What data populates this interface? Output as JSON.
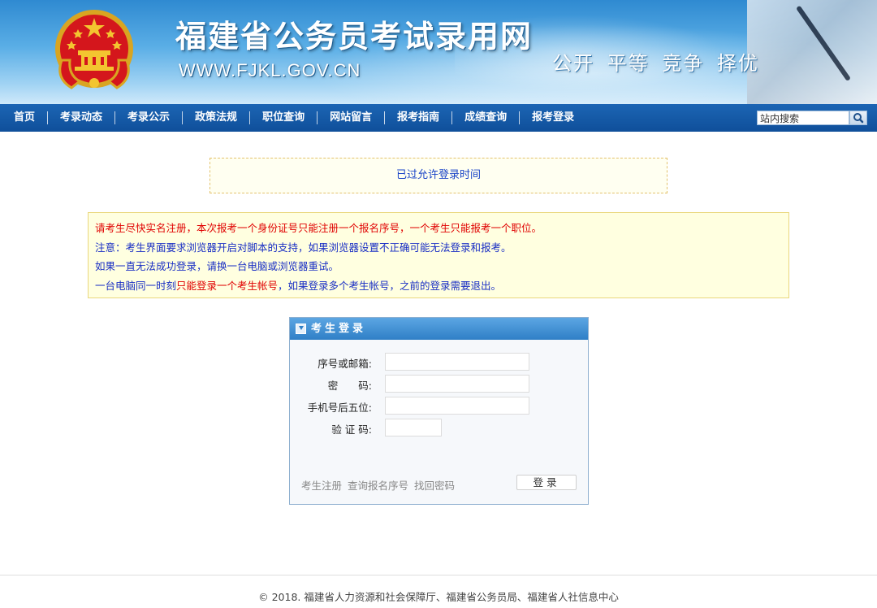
{
  "header": {
    "site_title": "福建省公务员考试录用网",
    "site_url": "WWW.FJKL.GOV.CN",
    "slogan": "公开 平等 竞争 择优"
  },
  "nav": {
    "items": [
      "首页",
      "考录动态",
      "考录公示",
      "政策法规",
      "职位查询",
      "网站留言",
      "报考指南",
      "成绩查询",
      "报考登录"
    ],
    "search_placeholder": "站内搜索"
  },
  "notice": {
    "login_time": "已过允许登录时间"
  },
  "warnings": {
    "line1": "请考生尽快实名注册，本次报考一个身份证号只能注册一个报名序号，一个考生只能报考一个职位。",
    "line2": "注意：考生界面要求浏览器开启对脚本的支持，如果浏览器设置不正确可能无法登录和报考。",
    "line3": "如果一直无法成功登录，请换一台电脑或浏览器重试。",
    "line4_a": "一台电脑同一时刻",
    "line4_b": "只能登录一个考生帐号",
    "line4_c": "，如果登录多个考生帐号，之前的登录需要退出。"
  },
  "login": {
    "title": "考生登录",
    "fields": {
      "id_label": "序号或邮箱:",
      "password_label": "密　　码:",
      "phone_label": "手机号后五位:",
      "captcha_label": "验 证 码:"
    },
    "links": [
      "考生注册",
      "查询报名序号",
      "找回密码"
    ],
    "submit": "登录"
  },
  "footer": {
    "copyright": "© 2018. 福建省人力资源和社会保障厅、福建省公务员局、福建省人社信息中心"
  },
  "colors": {
    "nav_bg": "#0f4f9a",
    "panel_head": "#2f7fc6",
    "warn_red": "#e00000",
    "warn_blue": "#1a2fc4"
  }
}
